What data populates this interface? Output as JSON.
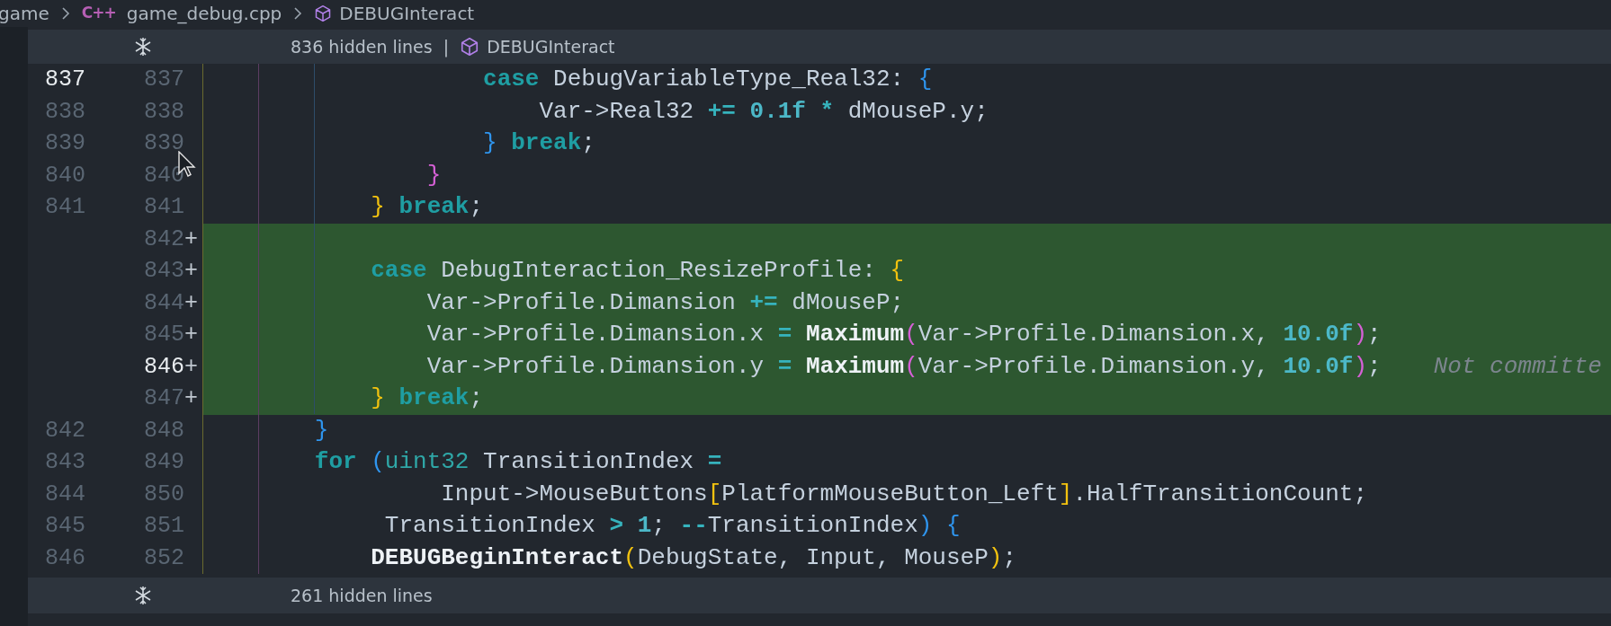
{
  "breadcrumb": {
    "items": [
      {
        "kind": "folder",
        "text": "game"
      },
      {
        "kind": "file",
        "icon_text": "C++",
        "text": "game_debug.cpp"
      },
      {
        "kind": "symbol",
        "text": "DEBUGInteract"
      }
    ]
  },
  "hidden_top": {
    "text": "836 hidden lines",
    "separator": "|",
    "symbol": "DEBUGInteract"
  },
  "lines": [
    {
      "old": {
        "text": "837",
        "active": true
      },
      "new": {
        "text": "837",
        "active": false
      },
      "added": false,
      "tokens": [
        {
          "kind": "keyword",
          "text": "                    case"
        },
        {
          "kind": "plain",
          "text": " DebugVariableType_Real32: "
        },
        {
          "kind": "brace_blue",
          "text": "{"
        }
      ]
    },
    {
      "old": {
        "text": "838",
        "active": false
      },
      "new": {
        "text": "838",
        "active": false
      },
      "added": false,
      "tokens": [
        {
          "kind": "plain",
          "text": "                        Var->Real32 "
        },
        {
          "kind": "op",
          "text": "+="
        },
        {
          "kind": "number",
          "text": " 0.1f "
        },
        {
          "kind": "op",
          "text": "*"
        },
        {
          "kind": "plain",
          "text": " dMouseP.y;"
        }
      ]
    },
    {
      "old": {
        "text": "839",
        "active": false
      },
      "new": {
        "text": "839",
        "active": false
      },
      "added": false,
      "tokens": [
        {
          "kind": "brace_blue",
          "text": "                    }"
        },
        {
          "kind": "keyword",
          "text": " break"
        },
        {
          "kind": "plain",
          "text": ";"
        }
      ]
    },
    {
      "old": {
        "text": "840",
        "active": false
      },
      "new": {
        "text": "840",
        "active": false
      },
      "added": false,
      "tokens": [
        {
          "kind": "brace_pink",
          "text": "                }"
        }
      ]
    },
    {
      "old": {
        "text": "841",
        "active": false
      },
      "new": {
        "text": "841",
        "active": false
      },
      "added": false,
      "tokens": [
        {
          "kind": "brace_yellow",
          "text": "            }"
        },
        {
          "kind": "keyword",
          "text": " break"
        },
        {
          "kind": "plain",
          "text": ";"
        }
      ]
    },
    {
      "new": {
        "text": "842",
        "active": false
      },
      "marker": "+",
      "added": true
    },
    {
      "new": {
        "text": "843",
        "active": false
      },
      "marker": "+",
      "added": true,
      "tokens": [
        {
          "kind": "keyword",
          "text": "            case"
        },
        {
          "kind": "plain",
          "text": " DebugInteraction_ResizeProfile: "
        },
        {
          "kind": "brace_yellow",
          "text": "{"
        }
      ]
    },
    {
      "new": {
        "text": "844",
        "active": false
      },
      "marker": "+",
      "added": true,
      "tokens": [
        {
          "kind": "plain",
          "text": "                Var->Profile.Dimansion "
        },
        {
          "kind": "op",
          "text": "+="
        },
        {
          "kind": "plain",
          "text": " dMouseP;"
        }
      ]
    },
    {
      "new": {
        "text": "845",
        "active": false
      },
      "marker": "+",
      "added": true,
      "tokens": [
        {
          "kind": "plain",
          "text": "                Var->Profile.Dimansion.x "
        },
        {
          "kind": "op",
          "text": "= "
        },
        {
          "kind": "function",
          "text": "Maximum"
        },
        {
          "kind": "brace_pink",
          "text": "("
        },
        {
          "kind": "plain",
          "text": "Var->Profile.Dimansion.x, "
        },
        {
          "kind": "number",
          "text": "10.0f"
        },
        {
          "kind": "brace_pink",
          "text": ")"
        },
        {
          "kind": "plain",
          "text": ";"
        }
      ]
    },
    {
      "new": {
        "text": "846",
        "active": true
      },
      "marker": "+",
      "added": true,
      "tokens": [
        {
          "kind": "plain",
          "text": "                Var->Profile.Dimansion.y "
        },
        {
          "kind": "op",
          "text": "= "
        },
        {
          "kind": "function",
          "text": "Maximum"
        },
        {
          "kind": "brace_pink",
          "text": "("
        },
        {
          "kind": "plain",
          "text": "Var->Profile.Dimansion.y, "
        },
        {
          "kind": "number",
          "text": "10.0f"
        },
        {
          "kind": "brace_pink",
          "text": ")"
        },
        {
          "kind": "plain",
          "text": ";"
        },
        {
          "kind": "blame",
          "text": "Not committe"
        }
      ]
    },
    {
      "new": {
        "text": "847",
        "active": false
      },
      "marker": "+",
      "added": true,
      "tokens": [
        {
          "kind": "brace_yellow",
          "text": "            }"
        },
        {
          "kind": "keyword",
          "text": " break"
        },
        {
          "kind": "plain",
          "text": ";"
        }
      ]
    },
    {
      "old": {
        "text": "842",
        "active": false
      },
      "new": {
        "text": "848",
        "active": false
      },
      "added": false,
      "tokens": [
        {
          "kind": "brace_blue",
          "text": "        }"
        }
      ]
    },
    {
      "old": {
        "text": "843",
        "active": false
      },
      "new": {
        "text": "849",
        "active": false
      },
      "added": false,
      "tokens": [
        {
          "kind": "keyword",
          "text": "        for"
        },
        {
          "kind": "brace_blue",
          "text": " ("
        },
        {
          "kind": "type",
          "text": "uint32"
        },
        {
          "kind": "plain",
          "text": " TransitionIndex "
        },
        {
          "kind": "op",
          "text": "="
        }
      ]
    },
    {
      "old": {
        "text": "844",
        "active": false
      },
      "new": {
        "text": "850",
        "active": false
      },
      "added": false,
      "tokens": [
        {
          "kind": "plain",
          "text": "                 Input->MouseButtons"
        },
        {
          "kind": "brace_yellow",
          "text": "["
        },
        {
          "kind": "plain",
          "text": "PlatformMouseButton_Left"
        },
        {
          "kind": "brace_yellow",
          "text": "]"
        },
        {
          "kind": "plain",
          "text": ".HalfTransitionCount;"
        }
      ]
    },
    {
      "old": {
        "text": "845",
        "active": false
      },
      "new": {
        "text": "851",
        "active": false
      },
      "added": false,
      "tokens": [
        {
          "kind": "plain",
          "text": "             TransitionIndex "
        },
        {
          "kind": "op",
          "text": ">"
        },
        {
          "kind": "number",
          "text": " 1"
        },
        {
          "kind": "plain",
          "text": "; "
        },
        {
          "kind": "op",
          "text": "--"
        },
        {
          "kind": "plain",
          "text": "TransitionIndex"
        },
        {
          "kind": "brace_blue",
          "text": ")"
        },
        {
          "kind": "brace_blue",
          "text": " {"
        }
      ]
    },
    {
      "old": {
        "text": "846",
        "active": false
      },
      "new": {
        "text": "852",
        "active": false
      },
      "added": false,
      "tokens": [
        {
          "kind": "function",
          "text": "            DEBUGBeginInteract"
        },
        {
          "kind": "brace_yellow",
          "text": "("
        },
        {
          "kind": "plain",
          "text": "DebugState, Input, MouseP"
        },
        {
          "kind": "brace_yellow",
          "text": ")"
        },
        {
          "kind": "plain",
          "text": ";"
        }
      ]
    }
  ],
  "hidden_bottom": {
    "text": "261 hidden lines"
  }
}
